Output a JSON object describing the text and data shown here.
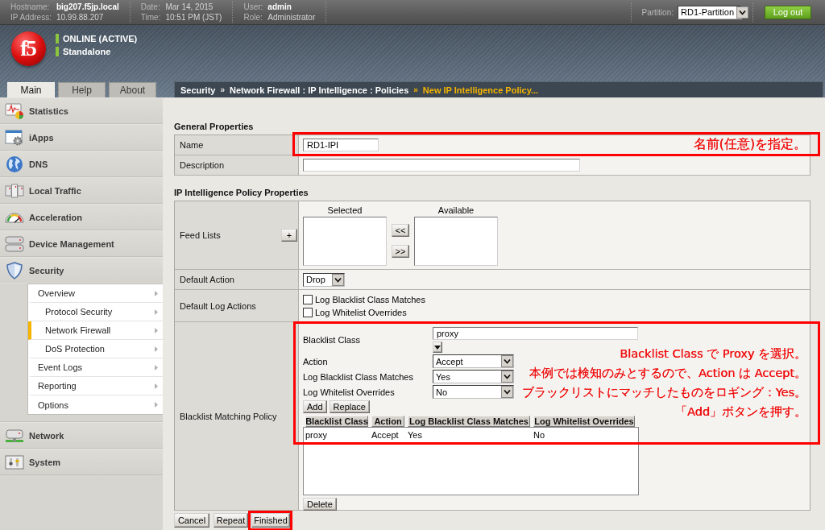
{
  "top_bar": {
    "info_columns": [
      {
        "rows": [
          {
            "label": "Hostname:",
            "value": "big207.f5jp.local",
            "strong": true
          },
          {
            "label": "IP Address:",
            "value": "10.99.88.207",
            "strong": false
          }
        ]
      },
      {
        "rows": [
          {
            "label": "Date:",
            "value": "Mar 14, 2015",
            "strong": false
          },
          {
            "label": "Time:",
            "value": "10:51 PM (JST)",
            "strong": false
          }
        ]
      },
      {
        "rows": [
          {
            "label": "User:",
            "value": "admin",
            "strong": true
          },
          {
            "label": "Role:",
            "value": "Administrator",
            "strong": false
          }
        ]
      }
    ],
    "partition": {
      "label": "Partition:",
      "value": "RD1-Partition"
    },
    "logout_button": "Log out"
  },
  "banner": {
    "logo": "f5",
    "status": [
      "ONLINE (ACTIVE)",
      "Standalone"
    ]
  },
  "tabs": [
    {
      "label": "Main",
      "selected": true
    },
    {
      "label": "Help",
      "selected": false
    },
    {
      "label": "About",
      "selected": false
    }
  ],
  "breadcrumb": [
    {
      "kind": "link",
      "text": "Security"
    },
    {
      "kind": "separator",
      "text": "»"
    },
    {
      "kind": "link",
      "text": "Network Firewall : IP Intelligence : Policies"
    },
    {
      "kind": "separator",
      "text": "»"
    },
    {
      "kind": "current",
      "text": "New IP Intelligence Policy..."
    }
  ],
  "sidebar": {
    "items": [
      {
        "label": "Statistics",
        "expanded": false
      },
      {
        "label": "iApps",
        "expanded": false
      },
      {
        "label": "DNS",
        "expanded": false
      },
      {
        "label": "Local Traffic",
        "expanded": false
      },
      {
        "label": "Acceleration",
        "expanded": false
      },
      {
        "label": "Device Management",
        "expanded": false
      },
      {
        "label": "Security",
        "expanded": true,
        "children": [
          {
            "label": "Overview",
            "selected": false,
            "children": [
              {
                "label": "Protocol Security",
                "selected": false
              },
              {
                "label": "Network Firewall",
                "selected": true
              },
              {
                "label": "DoS Protection",
                "selected": false
              }
            ]
          },
          {
            "label": "Event Logs",
            "selected": false
          },
          {
            "label": "Reporting",
            "selected": false
          },
          {
            "label": "Options",
            "selected": false
          }
        ]
      },
      {
        "label": "Network",
        "expanded": false
      },
      {
        "label": "System",
        "expanded": false
      }
    ]
  },
  "general_properties": {
    "title": "General Properties",
    "fields": [
      {
        "label": "Name",
        "value": "RD1-IPI"
      },
      {
        "label": "Description"
      }
    ]
  },
  "policy_properties": {
    "title": "IP Intelligence Policy Properties",
    "rows": [
      {
        "kind": "feed_lists",
        "label": "Feed Lists",
        "add_button": "+",
        "list_headings": [
          "Selected",
          "Available"
        ],
        "move_buttons": [
          "<<",
          ">>"
        ]
      },
      {
        "kind": "select",
        "label": "Default Action",
        "value": "Drop"
      },
      {
        "kind": "checkboxes",
        "label": "Default Log Actions",
        "options": [
          {
            "label": "Log Blacklist Class Matches",
            "checked": false
          },
          {
            "label": "Log Whitelist Overrides",
            "checked": false
          }
        ]
      },
      {
        "kind": "matching_policy",
        "label": "Blacklist Matching Policy",
        "fields": [
          {
            "kind": "combo",
            "label": "Blacklist Class",
            "value": "proxy"
          },
          {
            "kind": "select",
            "label": "Action",
            "value": "Accept"
          },
          {
            "kind": "select",
            "label": "Log Blacklist Class Matches",
            "value": "Yes"
          },
          {
            "kind": "select",
            "label": "Log Whitelist Overrides",
            "value": "No"
          }
        ],
        "buttons": [
          "Add",
          "Replace"
        ],
        "table": {
          "columns": [
            "Blacklist Class",
            "Action",
            "Log Blacklist Class Matches",
            "Log Whitelist Overrides"
          ],
          "rows": [
            [
              "proxy",
              "Accept",
              "Yes",
              "No"
            ]
          ]
        },
        "delete_button": "Delete"
      }
    ]
  },
  "form_buttons": [
    "Cancel",
    "Repeat",
    "Finished"
  ],
  "annotations": [
    {
      "kind": "note",
      "lines": [
        "名前(任意)を指定。"
      ]
    },
    {
      "kind": "note",
      "lines": [
        "Blacklist Class で Proxy を選択。",
        "本例では検知のみとするので、Action は Accept。",
        "ブラックリストにマッチしたものをロギング：Yes。",
        "「Add」ボタンを押す。"
      ]
    },
    {
      "kind": "frame"
    }
  ]
}
